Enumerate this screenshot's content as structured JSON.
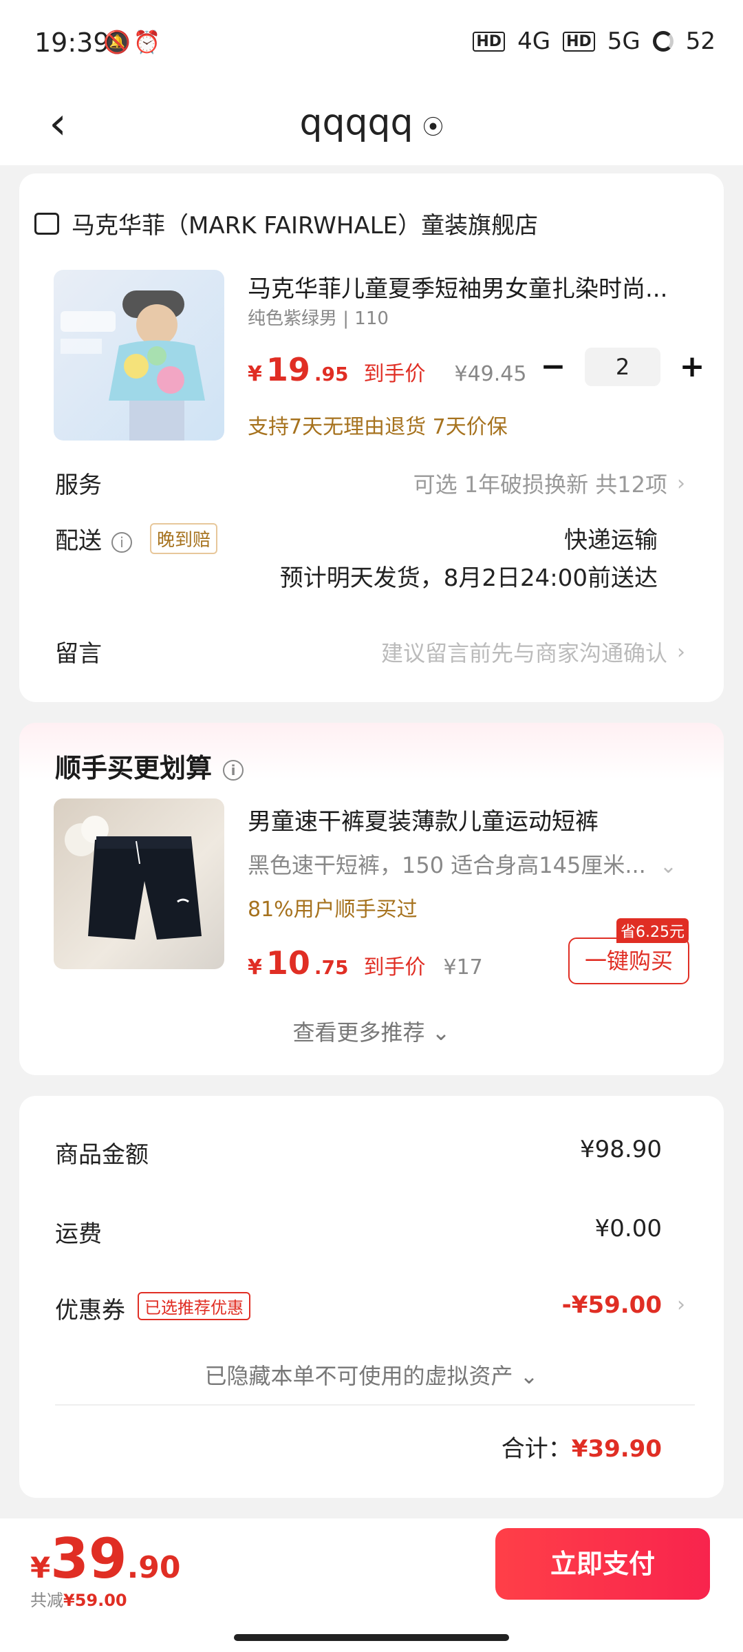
{
  "status_bar": {
    "time": "19:39",
    "signal_1": "4G",
    "signal_2": "5G",
    "battery": "52"
  },
  "nav": {
    "title": "qqqqq"
  },
  "order": {
    "store_name": "马克华菲（MARK FAIRWHALE）童装旗舰店",
    "product": {
      "title": "马克华菲儿童夏季短袖男女童扎染时尚...",
      "sku": "纯色紫绿男 | 110",
      "price_yen": "¥",
      "price_int": "19",
      "price_dec": ".95",
      "price_label": "到手价",
      "original_price": "¥49.45",
      "quantity": "2",
      "minus": "−",
      "plus": "+",
      "support": "支持7天无理由退货  7天价保"
    },
    "service": {
      "label": "服务",
      "value": "可选 1年破损换新 共12项"
    },
    "delivery": {
      "label": "配送",
      "badge": "晚到赔",
      "method": "快递运输",
      "eta": "预计明天发货，8月2日24:00前送达"
    },
    "message": {
      "label": "留言",
      "placeholder": "建议留言前先与商家沟通确认"
    }
  },
  "upsell": {
    "title": "顺手买更划算",
    "product": {
      "title": "男童速干裤夏装薄款儿童运动短裤",
      "sku": "黑色速干短裤，150 适合身高145厘米...",
      "bought": "81%用户顺手买过",
      "price_yen": "¥",
      "price_int": "10",
      "price_dec": ".75",
      "price_label": "到手价",
      "original_price": "¥17",
      "save_badge": "省6.25元",
      "buy_label": "一键购买"
    },
    "more": "查看更多推荐 ⌄"
  },
  "summary": {
    "goods_label": "商品金额",
    "goods_value": "¥98.90",
    "shipping_label": "运费",
    "shipping_value": "¥0.00",
    "coupon_label": "优惠券",
    "coupon_tag": "已选推荐优惠",
    "coupon_value": "-¥59.00",
    "hidden_assets": "已隐藏本单不可使用的虚拟资产 ⌄",
    "total_label": "合计：",
    "total_value": "¥39.90"
  },
  "bottom": {
    "yen": "¥",
    "int": "39",
    "dec": ".90",
    "saved_label": "共减",
    "saved_value": "¥59.00",
    "pay_label": "立即支付"
  },
  "colors": {
    "accent": "#e02e24",
    "gold": "#a6721e"
  }
}
